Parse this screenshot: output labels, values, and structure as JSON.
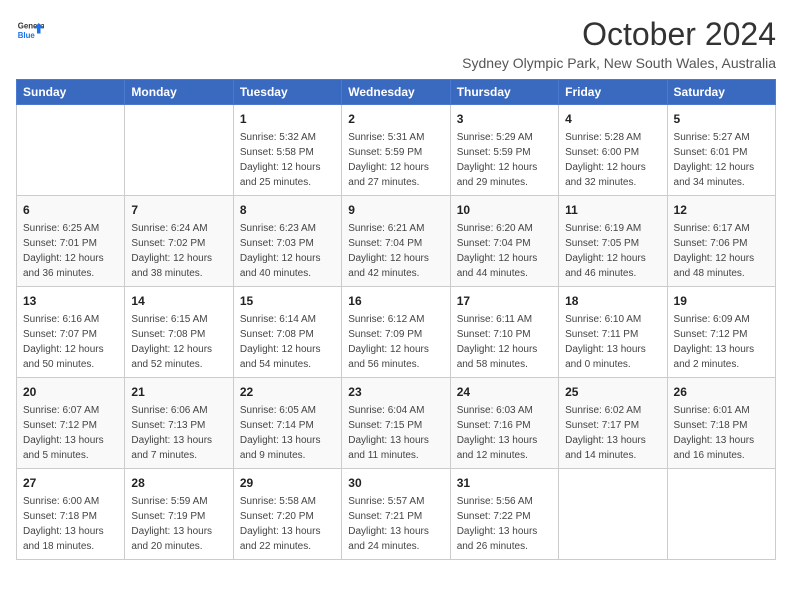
{
  "header": {
    "logo_line1": "General",
    "logo_line2": "Blue",
    "title": "October 2024",
    "subtitle": "Sydney Olympic Park, New South Wales, Australia"
  },
  "days_of_week": [
    "Sunday",
    "Monday",
    "Tuesday",
    "Wednesday",
    "Thursday",
    "Friday",
    "Saturday"
  ],
  "weeks": [
    [
      {
        "day": "",
        "details": ""
      },
      {
        "day": "",
        "details": ""
      },
      {
        "day": "1",
        "details": "Sunrise: 5:32 AM\nSunset: 5:58 PM\nDaylight: 12 hours\nand 25 minutes."
      },
      {
        "day": "2",
        "details": "Sunrise: 5:31 AM\nSunset: 5:59 PM\nDaylight: 12 hours\nand 27 minutes."
      },
      {
        "day": "3",
        "details": "Sunrise: 5:29 AM\nSunset: 5:59 PM\nDaylight: 12 hours\nand 29 minutes."
      },
      {
        "day": "4",
        "details": "Sunrise: 5:28 AM\nSunset: 6:00 PM\nDaylight: 12 hours\nand 32 minutes."
      },
      {
        "day": "5",
        "details": "Sunrise: 5:27 AM\nSunset: 6:01 PM\nDaylight: 12 hours\nand 34 minutes."
      }
    ],
    [
      {
        "day": "6",
        "details": "Sunrise: 6:25 AM\nSunset: 7:01 PM\nDaylight: 12 hours\nand 36 minutes."
      },
      {
        "day": "7",
        "details": "Sunrise: 6:24 AM\nSunset: 7:02 PM\nDaylight: 12 hours\nand 38 minutes."
      },
      {
        "day": "8",
        "details": "Sunrise: 6:23 AM\nSunset: 7:03 PM\nDaylight: 12 hours\nand 40 minutes."
      },
      {
        "day": "9",
        "details": "Sunrise: 6:21 AM\nSunset: 7:04 PM\nDaylight: 12 hours\nand 42 minutes."
      },
      {
        "day": "10",
        "details": "Sunrise: 6:20 AM\nSunset: 7:04 PM\nDaylight: 12 hours\nand 44 minutes."
      },
      {
        "day": "11",
        "details": "Sunrise: 6:19 AM\nSunset: 7:05 PM\nDaylight: 12 hours\nand 46 minutes."
      },
      {
        "day": "12",
        "details": "Sunrise: 6:17 AM\nSunset: 7:06 PM\nDaylight: 12 hours\nand 48 minutes."
      }
    ],
    [
      {
        "day": "13",
        "details": "Sunrise: 6:16 AM\nSunset: 7:07 PM\nDaylight: 12 hours\nand 50 minutes."
      },
      {
        "day": "14",
        "details": "Sunrise: 6:15 AM\nSunset: 7:08 PM\nDaylight: 12 hours\nand 52 minutes."
      },
      {
        "day": "15",
        "details": "Sunrise: 6:14 AM\nSunset: 7:08 PM\nDaylight: 12 hours\nand 54 minutes."
      },
      {
        "day": "16",
        "details": "Sunrise: 6:12 AM\nSunset: 7:09 PM\nDaylight: 12 hours\nand 56 minutes."
      },
      {
        "day": "17",
        "details": "Sunrise: 6:11 AM\nSunset: 7:10 PM\nDaylight: 12 hours\nand 58 minutes."
      },
      {
        "day": "18",
        "details": "Sunrise: 6:10 AM\nSunset: 7:11 PM\nDaylight: 13 hours\nand 0 minutes."
      },
      {
        "day": "19",
        "details": "Sunrise: 6:09 AM\nSunset: 7:12 PM\nDaylight: 13 hours\nand 2 minutes."
      }
    ],
    [
      {
        "day": "20",
        "details": "Sunrise: 6:07 AM\nSunset: 7:12 PM\nDaylight: 13 hours\nand 5 minutes."
      },
      {
        "day": "21",
        "details": "Sunrise: 6:06 AM\nSunset: 7:13 PM\nDaylight: 13 hours\nand 7 minutes."
      },
      {
        "day": "22",
        "details": "Sunrise: 6:05 AM\nSunset: 7:14 PM\nDaylight: 13 hours\nand 9 minutes."
      },
      {
        "day": "23",
        "details": "Sunrise: 6:04 AM\nSunset: 7:15 PM\nDaylight: 13 hours\nand 11 minutes."
      },
      {
        "day": "24",
        "details": "Sunrise: 6:03 AM\nSunset: 7:16 PM\nDaylight: 13 hours\nand 12 minutes."
      },
      {
        "day": "25",
        "details": "Sunrise: 6:02 AM\nSunset: 7:17 PM\nDaylight: 13 hours\nand 14 minutes."
      },
      {
        "day": "26",
        "details": "Sunrise: 6:01 AM\nSunset: 7:18 PM\nDaylight: 13 hours\nand 16 minutes."
      }
    ],
    [
      {
        "day": "27",
        "details": "Sunrise: 6:00 AM\nSunset: 7:18 PM\nDaylight: 13 hours\nand 18 minutes."
      },
      {
        "day": "28",
        "details": "Sunrise: 5:59 AM\nSunset: 7:19 PM\nDaylight: 13 hours\nand 20 minutes."
      },
      {
        "day": "29",
        "details": "Sunrise: 5:58 AM\nSunset: 7:20 PM\nDaylight: 13 hours\nand 22 minutes."
      },
      {
        "day": "30",
        "details": "Sunrise: 5:57 AM\nSunset: 7:21 PM\nDaylight: 13 hours\nand 24 minutes."
      },
      {
        "day": "31",
        "details": "Sunrise: 5:56 AM\nSunset: 7:22 PM\nDaylight: 13 hours\nand 26 minutes."
      },
      {
        "day": "",
        "details": ""
      },
      {
        "day": "",
        "details": ""
      }
    ]
  ]
}
